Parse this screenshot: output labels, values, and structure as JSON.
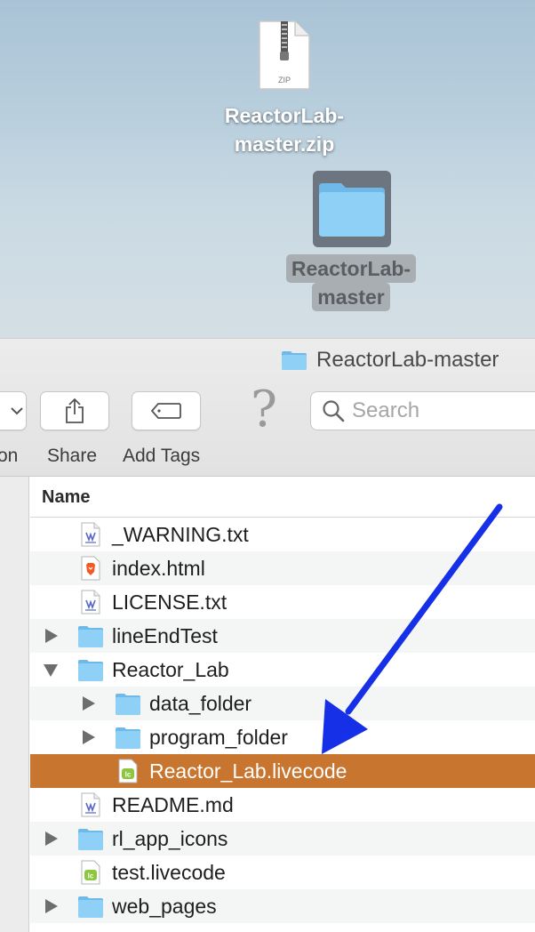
{
  "desktop": {
    "zip_file": {
      "line1": "ReactorLab-",
      "line2": "master.zip",
      "badge": "ZIP"
    },
    "folder": {
      "line1": "ReactorLab-",
      "line2": "master"
    }
  },
  "window": {
    "title": "ReactorLab-master",
    "toolbar": {
      "view_label_fragment": "on",
      "share_label": "Share",
      "add_tags_label": "Add Tags",
      "help_glyph": "?",
      "search_placeholder": "Search"
    },
    "list_header": {
      "name": "Name"
    },
    "files": [
      {
        "name": "_WARNING.txt",
        "icon": "text-file-icon",
        "level": 0,
        "disclosure": "none"
      },
      {
        "name": "index.html",
        "icon": "brave-html-icon",
        "level": 0,
        "disclosure": "none"
      },
      {
        "name": "LICENSE.txt",
        "icon": "text-file-icon",
        "level": 0,
        "disclosure": "none"
      },
      {
        "name": "lineEndTest",
        "icon": "folder-icon",
        "level": 0,
        "disclosure": "collapsed"
      },
      {
        "name": "Reactor_Lab",
        "icon": "folder-icon",
        "level": 0,
        "disclosure": "expanded"
      },
      {
        "name": "data_folder",
        "icon": "folder-icon",
        "level": 1,
        "disclosure": "collapsed"
      },
      {
        "name": "program_folder",
        "icon": "folder-icon",
        "level": 1,
        "disclosure": "collapsed"
      },
      {
        "name": "Reactor_Lab.livecode",
        "icon": "livecode-file-icon",
        "level": 1,
        "disclosure": "none",
        "selected": true
      },
      {
        "name": "README.md",
        "icon": "text-file-icon",
        "level": 0,
        "disclosure": "none"
      },
      {
        "name": "rl_app_icons",
        "icon": "folder-icon",
        "level": 0,
        "disclosure": "collapsed"
      },
      {
        "name": "test.livecode",
        "icon": "livecode-file-icon",
        "level": 0,
        "disclosure": "none"
      },
      {
        "name": "web_pages",
        "icon": "folder-icon",
        "level": 0,
        "disclosure": "collapsed"
      }
    ]
  },
  "colors": {
    "selection": "#c87530",
    "arrow": "#1530e6",
    "folder": "#7cc4f0"
  }
}
